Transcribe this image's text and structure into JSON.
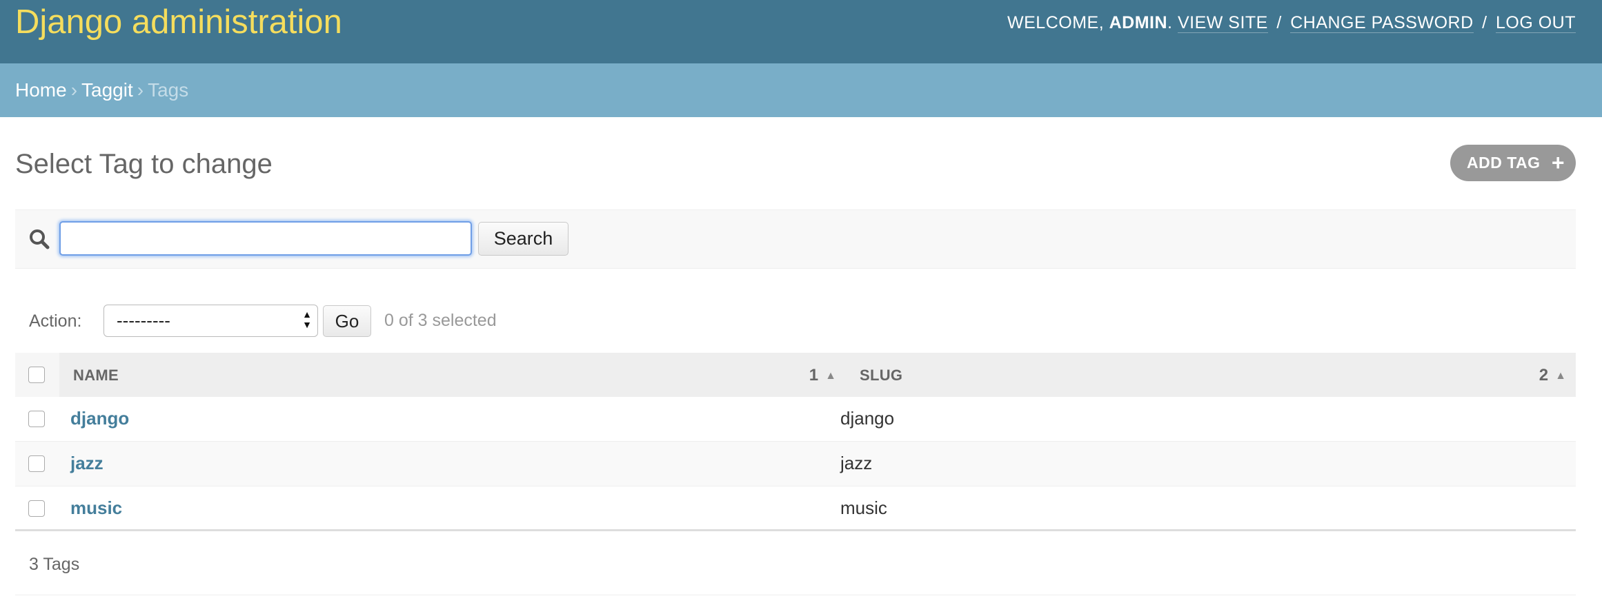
{
  "header": {
    "branding": "Django administration",
    "welcome": "WELCOME, ",
    "username": "ADMIN",
    "after_username": ".",
    "view_site": "VIEW SITE",
    "change_password": "CHANGE PASSWORD",
    "log_out": "LOG OUT",
    "separator": "/"
  },
  "breadcrumbs": {
    "home": "Home",
    "app": "Taggit",
    "current": "Tags",
    "separator": "›"
  },
  "content": {
    "title": "Select Tag to change",
    "add_button": "ADD TAG",
    "add_icon": "+"
  },
  "search": {
    "icon": "search-icon",
    "value": "",
    "placeholder": "",
    "button": "Search"
  },
  "actions": {
    "label": "Action:",
    "selected_option": "---------",
    "go": "Go",
    "selection_count": "0 of 3 selected"
  },
  "table": {
    "columns": [
      {
        "label": "NAME",
        "sort_priority": "1",
        "sort_dir": "ascending"
      },
      {
        "label": "SLUG",
        "sort_priority": "2",
        "sort_dir": "ascending"
      }
    ],
    "rows": [
      {
        "name": "django",
        "slug": "django"
      },
      {
        "name": "jazz",
        "slug": "jazz"
      },
      {
        "name": "music",
        "slug": "music"
      }
    ]
  },
  "paginator": {
    "text": "3 Tags"
  },
  "colors": {
    "header_bg": "#417690",
    "branding": "#f5dd5d",
    "breadcrumbs_bg": "#79aec8",
    "link": "#447e9b"
  }
}
